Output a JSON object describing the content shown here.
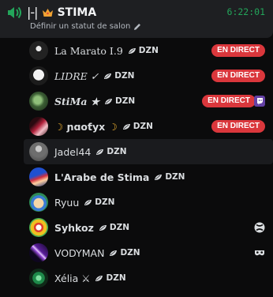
{
  "channel": {
    "symbol": "|-|",
    "name": "STIMA",
    "timer": "6:22:01",
    "status_placeholder": "Définir un statut de salon"
  },
  "colors": {
    "accent_green": "#23a55a",
    "live_red": "#da373c",
    "header_bg": "#1e1f22"
  },
  "members": [
    {
      "name": "La Marato I.9",
      "tag": "DZN",
      "live": "EN DIRECT",
      "avatar": "avatar-dark-figure"
    },
    {
      "name": "LIDRE ✓",
      "tag": "DZN",
      "live": "EN DIRECT",
      "avatar": "avatar-white-ghost"
    },
    {
      "name": "StiMa ★",
      "tag": "DZN",
      "live": "EN DIRECT",
      "activity": "twitch-icon",
      "avatar": "avatar-green-ball"
    },
    {
      "name": "ɲɑoƭуx",
      "tag": "DZN",
      "live": "EN DIRECT",
      "avatar": "avatar-red-character"
    },
    {
      "name": "Jadel44",
      "tag": "DZN",
      "avatar": "avatar-grey-figure"
    },
    {
      "name": "L'Arabe de Stima",
      "tag": "DZN",
      "avatar": "avatar-blue-character"
    },
    {
      "name": "Ryuu",
      "tag": "DZN",
      "avatar": "avatar-cartoon-face"
    },
    {
      "name": "Syhkoz",
      "tag": "DZN",
      "activity": "xbox-icon",
      "avatar": "avatar-clown"
    },
    {
      "name": "VODYMAN",
      "tag": "DZN",
      "activity": "mask-icon",
      "avatar": "avatar-purple-sword"
    },
    {
      "name": "Xélia ⚔",
      "tag": "DZN",
      "avatar": "avatar-green-gem"
    }
  ]
}
